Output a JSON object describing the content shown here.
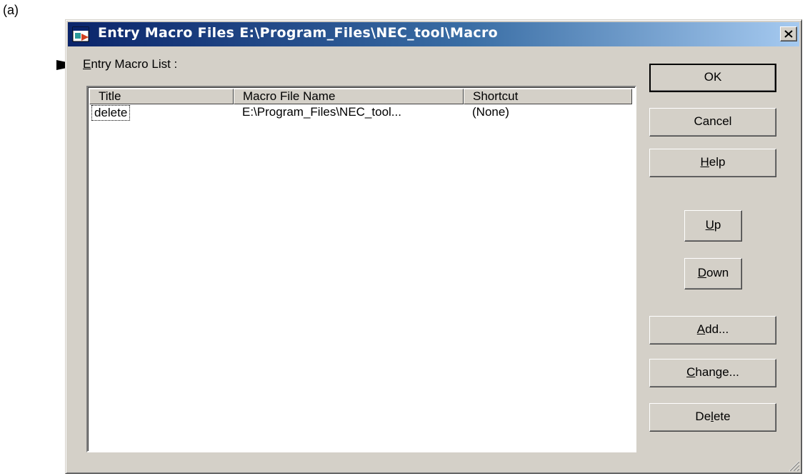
{
  "figure_label": "(a)",
  "window": {
    "title": "Entry Macro Files E:\\Program_Files\\NEC_tool\\Macro"
  },
  "list": {
    "label_mnemonic": "E",
    "label_rest": "ntry Macro List :",
    "columns": [
      "Title",
      "Macro File Name",
      "Shortcut"
    ],
    "rows": [
      {
        "title": "delete",
        "file": "E:\\Program_Files\\NEC_tool...",
        "shortcut": "(None)"
      }
    ]
  },
  "buttons": {
    "ok": {
      "pre": "",
      "mn": "",
      "post": "OK"
    },
    "cancel": {
      "pre": "",
      "mn": "",
      "post": "Cancel"
    },
    "help": {
      "pre": "",
      "mn": "H",
      "post": "elp"
    },
    "up": {
      "pre": "",
      "mn": "U",
      "post": "p"
    },
    "down": {
      "pre": "",
      "mn": "D",
      "post": "own"
    },
    "add": {
      "pre": "",
      "mn": "A",
      "post": "dd..."
    },
    "change": {
      "pre": "",
      "mn": "C",
      "post": "hange..."
    },
    "delete": {
      "pre": "De",
      "mn": "l",
      "post": "ete"
    }
  },
  "colors": {
    "titlebar_start": "#0a246a",
    "titlebar_end": "#a6caf0",
    "face": "#d4d0c8"
  },
  "icons": [
    "pointer-arrow-icon",
    "macro-app-icon",
    "close-icon",
    "resize-grip-icon"
  ]
}
